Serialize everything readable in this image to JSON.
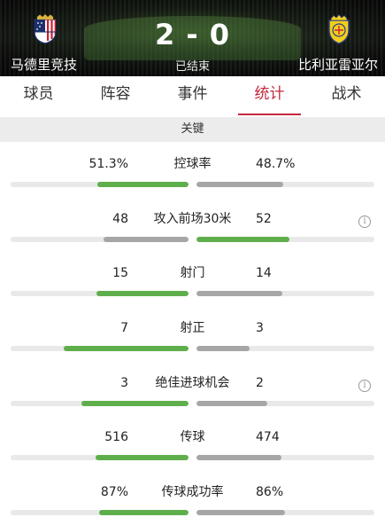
{
  "match": {
    "home_team": "马德里竞技",
    "away_team": "比利亚雷亚尔",
    "score": "2 - 0",
    "status": "已结束",
    "home_crest_icon": "atletico-madrid-crest-icon",
    "away_crest_icon": "villarreal-crest-icon"
  },
  "tabs": [
    {
      "label": "球员",
      "active": false
    },
    {
      "label": "阵容",
      "active": false
    },
    {
      "label": "事件",
      "active": false
    },
    {
      "label": "统计",
      "active": true
    },
    {
      "label": "战术",
      "active": false
    }
  ],
  "section_title": "关键",
  "colors": {
    "accent": "#c4283c",
    "home_bar": "#5fae4c",
    "away_bar": "#a6a6a6",
    "track": "#e9e9e9"
  },
  "stats": [
    {
      "label": "控球率",
      "home": "51.3%",
      "away": "48.7%",
      "home_value": 51.3,
      "away_value": 48.7,
      "leader": "home",
      "info": false
    },
    {
      "label": "攻入前场30米",
      "home": "48",
      "away": "52",
      "home_value": 48,
      "away_value": 52,
      "leader": "away",
      "info": true
    },
    {
      "label": "射门",
      "home": "15",
      "away": "14",
      "home_value": 15,
      "away_value": 14,
      "leader": "home",
      "info": false
    },
    {
      "label": "射正",
      "home": "7",
      "away": "3",
      "home_value": 7,
      "away_value": 3,
      "leader": "home",
      "info": false
    },
    {
      "label": "绝佳进球机会",
      "home": "3",
      "away": "2",
      "home_value": 3,
      "away_value": 2,
      "leader": "home",
      "info": true
    },
    {
      "label": "传球",
      "home": "516",
      "away": "474",
      "home_value": 516,
      "away_value": 474,
      "leader": "home",
      "info": false
    },
    {
      "label": "传球成功率",
      "home": "87%",
      "away": "86%",
      "home_value": 87,
      "away_value": 86,
      "leader": "home",
      "info": false
    }
  ]
}
